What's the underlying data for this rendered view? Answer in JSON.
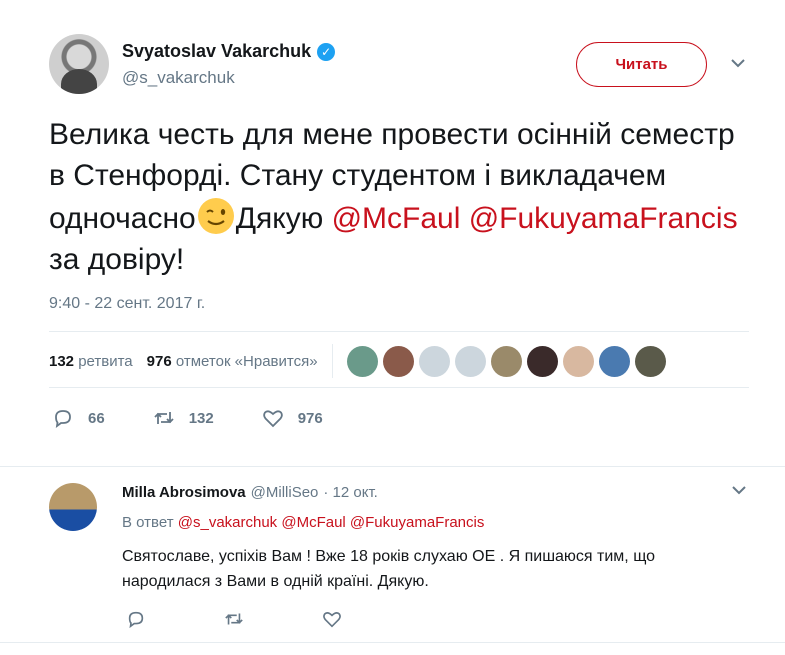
{
  "tweet": {
    "author_name": "Svyatoslav Vakarchuk",
    "author_handle": "@s_vakarchuk",
    "follow_label": "Читать",
    "text_part1": "Велика честь для мене провести осінній семестр в Стенфорді. Стану студентом і викладачем одночасно",
    "text_part2": "Дякую ",
    "mention1": "@McFaul",
    "mention2": "@FukuyamaFrancis",
    "text_part3": " за довіру!",
    "timestamp": "9:40 - 22 сент. 2017 г.",
    "retweets_count": "132",
    "retweets_label": "ретвита",
    "likes_count": "976",
    "likes_label": "отметок «Нравится»",
    "liker_count": 9,
    "actions": {
      "replies": "66",
      "retweets": "132",
      "likes": "976"
    }
  },
  "reply": {
    "author_name": "Milla Abrosimova",
    "author_handle": "@MilliSeo",
    "date": "· 12 окт.",
    "reply_to_label": "В ответ",
    "reply_to_mentions": "@s_vakarchuk @McFaul @FukuyamaFrancis",
    "text": "Святославе, успіхів Вам ! Вже 18 років слухаю ОЕ . Я пишаюся тим, що народилася з Вами в одній країні. Дякую."
  },
  "colors": {
    "accent": "#c8111d",
    "verified": "#1da1f2",
    "muted": "#657786",
    "text": "#14171a",
    "border": "#e6ecf0"
  }
}
